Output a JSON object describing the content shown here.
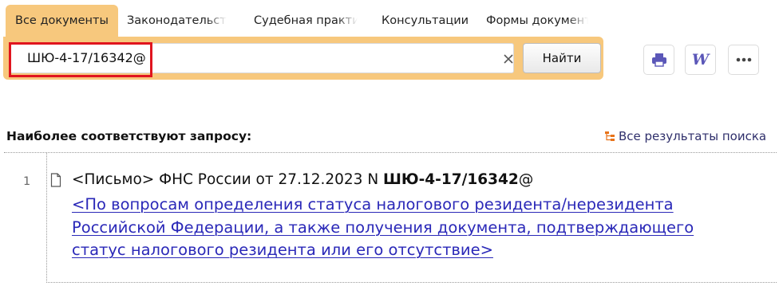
{
  "tabs": [
    {
      "label": "Все документы",
      "active": true
    },
    {
      "label": "Законодательство",
      "active": false
    },
    {
      "label": "Судебная практика",
      "active": false
    },
    {
      "label": "Консультации",
      "active": false
    },
    {
      "label": "Формы документов",
      "active": false
    }
  ],
  "search": {
    "value": "ШЮ-4-17/16342@",
    "button_label": "Найти",
    "clear_icon": "close-icon"
  },
  "toolbar": {
    "print_icon": "printer-icon",
    "word_icon": "word-export-icon",
    "word_glyph": "W",
    "more_icon": "more-icon"
  },
  "results": {
    "title": "Наиболее соответствуют запросу:",
    "all_results_label": "Все результаты поиска",
    "items": [
      {
        "number": "1",
        "head_prefix": "<Письмо> ФНС России от 27.12.2023 N ",
        "head_bold": "ШЮ-4-17/16342",
        "head_suffix": "@",
        "link_text": "<По вопросам определения статуса налогового резидента/нерезидента Российской Федерации, а также получения документа, подтверждающего статус налогового резидента или его отсутствие>"
      }
    ]
  },
  "colors": {
    "accent": "#f7c87d",
    "highlight": "#e0151f",
    "link": "#2a28b8",
    "tree_icon": "#e8731a"
  }
}
